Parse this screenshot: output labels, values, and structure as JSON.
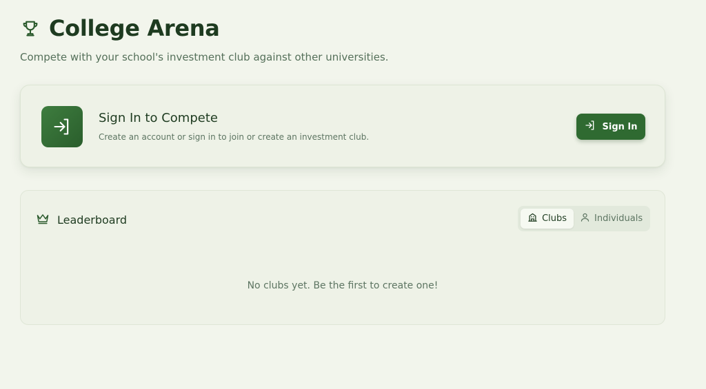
{
  "header": {
    "title": "College Arena",
    "subtitle": "Compete with your school's investment club against other universities.",
    "icon": "trophy-icon"
  },
  "signin_card": {
    "title": "Sign In to Compete",
    "description": "Create an account or sign in to join or create an investment club.",
    "button_label": "Sign In",
    "icon": "login-icon"
  },
  "leaderboard": {
    "title": "Leaderboard",
    "icon": "crown-icon",
    "tabs": [
      {
        "label": "Clubs",
        "icon": "building-icon",
        "selected": true
      },
      {
        "label": "Individuals",
        "icon": "user-icon",
        "selected": false
      }
    ],
    "empty_message": "No clubs yet. Be the first to create one!"
  },
  "colors": {
    "background": "#f2f5ec",
    "accent": "#2f6a31",
    "text": "#1e3b20",
    "muted": "#5d7562"
  }
}
